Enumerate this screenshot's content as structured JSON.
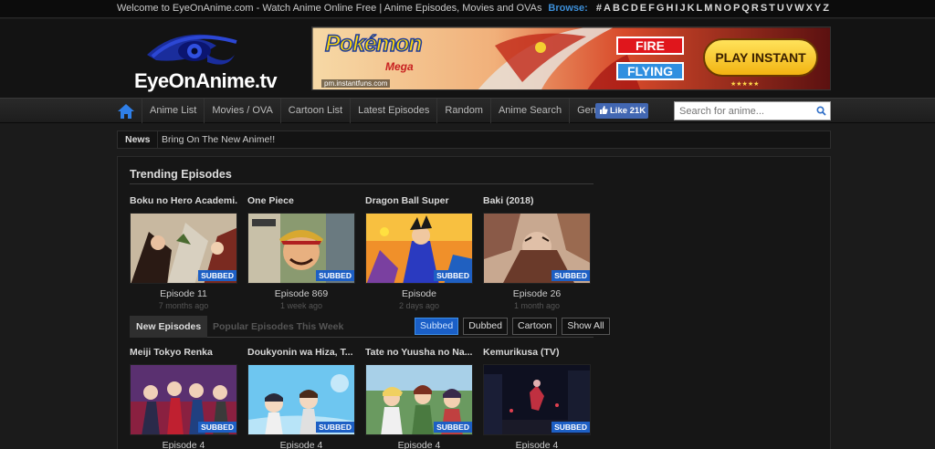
{
  "topbar": {
    "welcome": "Welcome to EyeOnAnime.com - Watch Anime Online Free | Anime Episodes, Movies and OVAs",
    "browse_label": "Browse:",
    "letters": [
      "#",
      "A",
      "B",
      "C",
      "D",
      "E",
      "F",
      "G",
      "H",
      "I",
      "J",
      "K",
      "L",
      "M",
      "N",
      "O",
      "P",
      "Q",
      "R",
      "S",
      "T",
      "U",
      "V",
      "W",
      "X",
      "Y",
      "Z"
    ]
  },
  "header": {
    "logo_text": "EyeOnAnime.tv",
    "banner": {
      "brand": "Pokémon",
      "brand_sub": "Mega",
      "type1": "FIRE",
      "type2": "FLYING",
      "cta": "PLAY INSTANT",
      "source": "pm.instantfuns.com"
    }
  },
  "nav": {
    "items": [
      "Anime List",
      "Movies / OVA",
      "Cartoon List",
      "Latest Episodes",
      "Random",
      "Anime Search",
      "Genres »"
    ],
    "like_label": "Like 21K",
    "search_placeholder": "Search for anime..."
  },
  "news": {
    "label": "News",
    "text": "Bring On The New Anime!!"
  },
  "trending": {
    "title": "Trending Episodes",
    "items": [
      {
        "title": "Boku no Hero Academi...",
        "episode": "Episode 11",
        "ago": "7 months ago",
        "badge": "SUBBED"
      },
      {
        "title": "One Piece",
        "episode": "Episode 869",
        "ago": "1 week ago",
        "badge": "SUBBED"
      },
      {
        "title": "Dragon Ball Super",
        "episode": "Episode",
        "ago": "2 days ago",
        "badge": "SUBBED"
      },
      {
        "title": "Baki (2018)",
        "episode": "Episode 26",
        "ago": "1 month ago",
        "badge": "SUBBED"
      }
    ]
  },
  "tabs": {
    "active": "New Episodes",
    "inactive": "Popular Episodes This Week",
    "filters": [
      "Subbed",
      "Dubbed",
      "Cartoon",
      "Show All"
    ]
  },
  "new_episodes": {
    "items": [
      {
        "title": "Meiji Tokyo Renka",
        "episode": "Episode 4",
        "badge": "SUBBED"
      },
      {
        "title": "Doukyonin wa Hiza, T...",
        "episode": "Episode 4",
        "badge": "SUBBED"
      },
      {
        "title": "Tate no Yuusha no Na...",
        "episode": "Episode 4",
        "badge": "SUBBED"
      },
      {
        "title": "Kemurikusa (TV)",
        "episode": "Episode 4",
        "badge": "SUBBED"
      }
    ]
  },
  "colors": {
    "accent": "#1d5fc4",
    "browse": "#3d8fd8",
    "background": "#1b1b1b"
  }
}
